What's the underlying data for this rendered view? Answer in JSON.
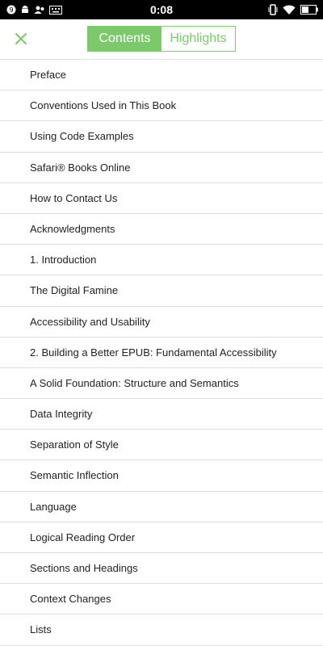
{
  "status_bar": {
    "time": "0:08",
    "left_icons": [
      "notification-count-icon",
      "android-icon",
      "contacts-icon",
      "keyboard-icon"
    ],
    "notification_count": "9",
    "right_icons": [
      "vibrate-icon",
      "wifi-icon",
      "battery-icon"
    ]
  },
  "header": {
    "close_icon": "close-icon",
    "tabs": [
      {
        "label": "Contents",
        "active": true
      },
      {
        "label": "Highlights",
        "active": false
      }
    ]
  },
  "colors": {
    "accent": "#7bc96a",
    "text": "#222222",
    "divider": "#dddddd"
  },
  "toc": {
    "items": [
      {
        "label": "Preface"
      },
      {
        "label": "Conventions Used in This Book"
      },
      {
        "label": "Using Code Examples"
      },
      {
        "label": "Safari® Books Online"
      },
      {
        "label": "How to Contact Us"
      },
      {
        "label": "Acknowledgments"
      },
      {
        "label": "1. Introduction"
      },
      {
        "label": "The Digital Famine"
      },
      {
        "label": "Accessibility and Usability"
      },
      {
        "label": "2. Building a Better EPUB: Fundamental Accessibility"
      },
      {
        "label": "A Solid Foundation: Structure and Semantics"
      },
      {
        "label": "Data Integrity"
      },
      {
        "label": "Separation of Style"
      },
      {
        "label": "Semantic Inflection"
      },
      {
        "label": "Language"
      },
      {
        "label": "Logical Reading Order"
      },
      {
        "label": "Sections and Headings"
      },
      {
        "label": "Context Changes"
      },
      {
        "label": "Lists"
      }
    ]
  }
}
